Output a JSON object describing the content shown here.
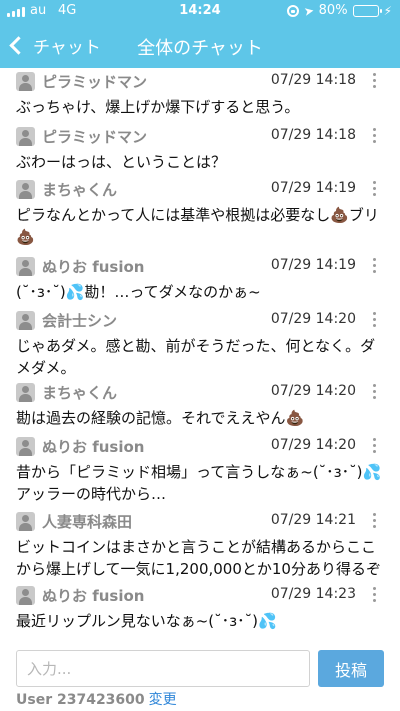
{
  "status_bar": {
    "carrier": "au",
    "network": "4G",
    "time": "14:24",
    "battery_percent": "80%",
    "battery_level": 0.8,
    "icons": [
      "signal-icon",
      "rotation-lock-icon",
      "location-arrow-icon",
      "battery-icon",
      "charging-bolt-icon"
    ]
  },
  "nav": {
    "back_label": "チャット",
    "title": "全体のチャット"
  },
  "messages": [
    {
      "name": "ピラミッドマン",
      "time": "07/29 14:18",
      "text": "ぶっちゃけ、爆上げか爆下げすると思う。"
    },
    {
      "name": "ピラミッドマン",
      "time": "07/29 14:18",
      "text": "ぶわーはっは、ということは？"
    },
    {
      "name": "まちゃくん",
      "time": "07/29 14:19",
      "text": "ピラなんとかって人には基準や根拠は必要なし💩ブリ\n💩"
    },
    {
      "name": "ぬりお fusion",
      "time": "07/29 14:19",
      "text": "(˘･з･˘)💦勘！…ってダメなのかぁ~"
    },
    {
      "name": "会計士シン",
      "time": "07/29 14:20",
      "text": "じゃあダメ。感と勘、前がそうだった、何となく。ダメダメ。"
    },
    {
      "name": "まちゃくん",
      "time": "07/29 14:20",
      "text": "勘は過去の経験の記憶。それでええやん💩"
    },
    {
      "name": "ぬりお fusion",
      "time": "07/29 14:20",
      "text": "昔から「ピラミッド相場」って言うしなぁ~(˘･з･˘)💦\nアッラーの時代から…"
    },
    {
      "name": "人妻専科森田",
      "time": "07/29 14:21",
      "text": "ビットコインはまさかと言うことが結構あるからここから爆上げして一気に1,200,000とか10分あり得るぞ"
    },
    {
      "name": "ぬりお fusion",
      "time": "07/29 14:23",
      "text": "最近リップルン見ないなぁ~(˘･з･˘)💦"
    }
  ],
  "composer": {
    "placeholder": "入力...",
    "post_label": "投稿",
    "user_label": "User 237423600",
    "change_label": "変更"
  },
  "colors": {
    "header": "#5ec6e8",
    "post_button": "#5ba8de",
    "link": "#2f86d8",
    "name_gray": "#8a8a8a"
  }
}
